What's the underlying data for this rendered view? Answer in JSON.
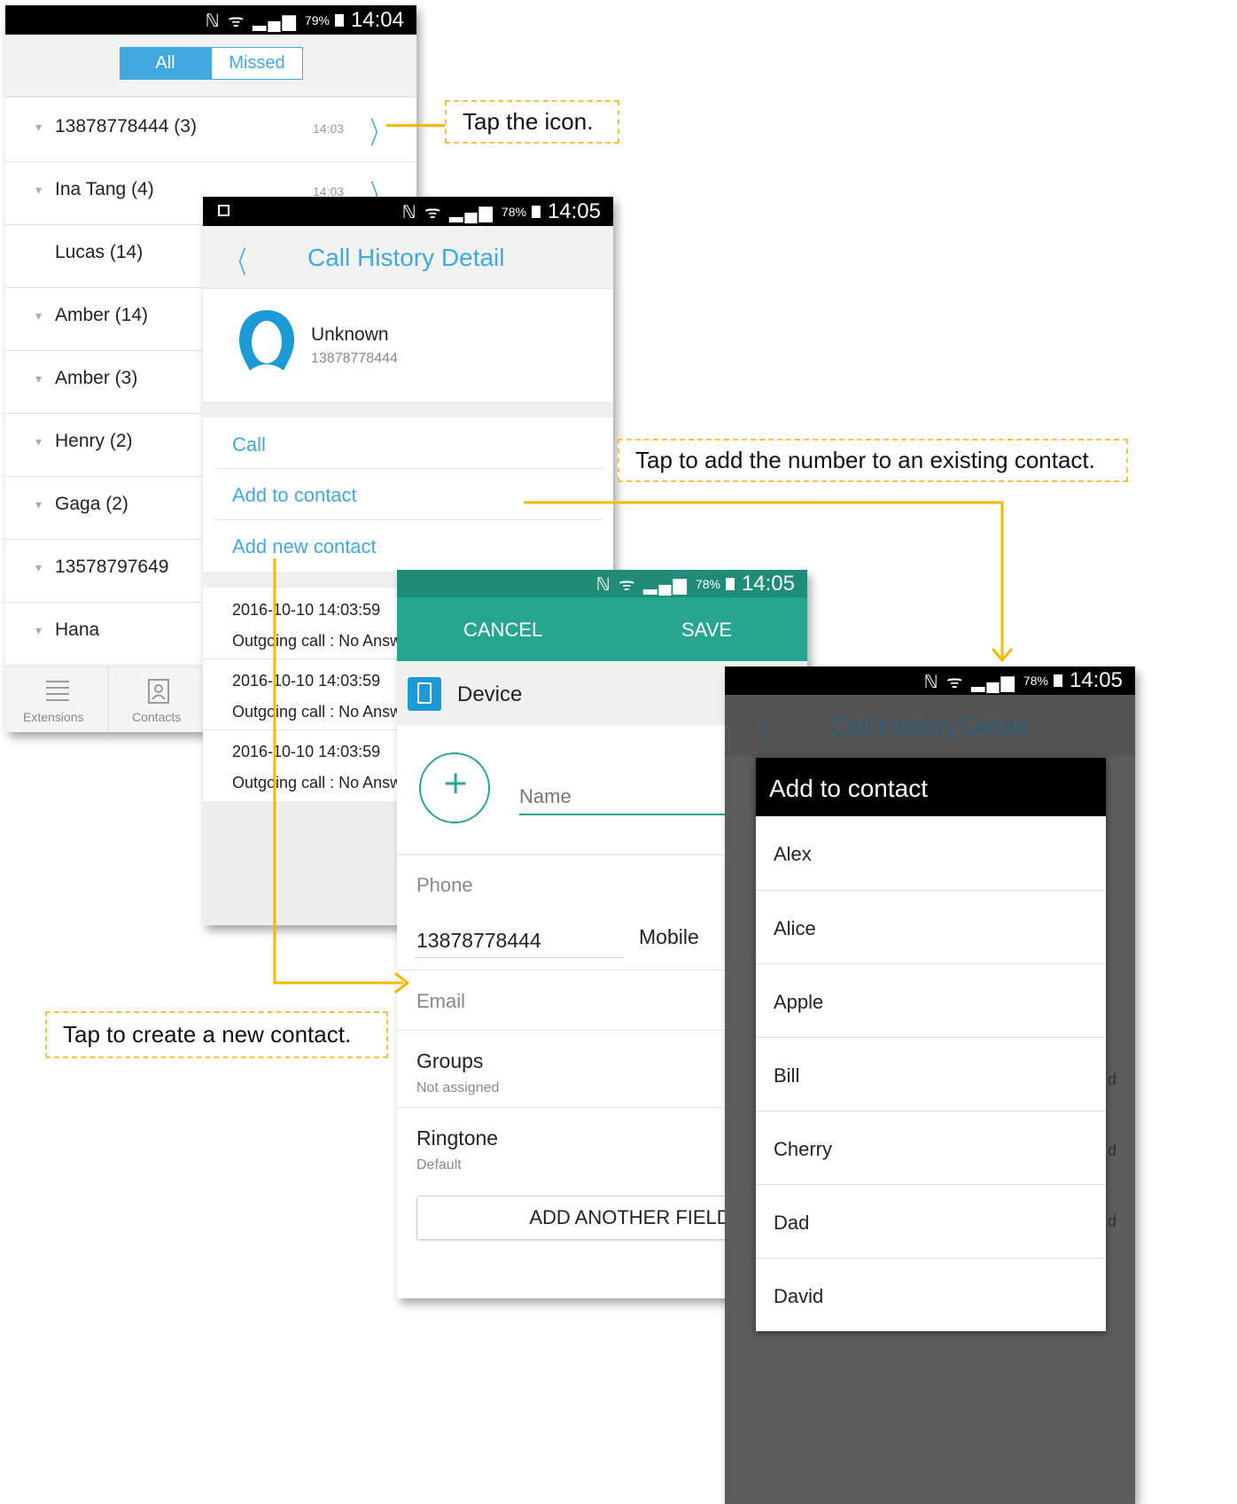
{
  "phone1": {
    "status": {
      "icons": "ℕ ᯤ ▂▄▆",
      "battery": "79%",
      "time": "14:04"
    },
    "filter": {
      "all": "All",
      "missed": "Missed"
    },
    "calls": [
      {
        "name": "13878778444 (3)",
        "time": "14:03",
        "icon": "▾",
        "chevron": "〉"
      },
      {
        "name": "Ina Tang (4)",
        "time": "14:03",
        "icon": "▾",
        "chevron": "〉"
      },
      {
        "name": "Lucas (14)",
        "time": "",
        "icon": "",
        "chevron": ""
      },
      {
        "name": "Amber (14)",
        "time": "",
        "icon": "▾",
        "chevron": ""
      },
      {
        "name": "Amber (3)",
        "time": "",
        "icon": "▾",
        "chevron": ""
      },
      {
        "name": "Henry (2)",
        "time": "",
        "icon": "▾",
        "chevron": ""
      },
      {
        "name": "Gaga (2)",
        "time": "",
        "icon": "▾",
        "chevron": ""
      },
      {
        "name": "13578797649",
        "time": "",
        "icon": "▾",
        "chevron": ""
      },
      {
        "name": "Hana",
        "time": "",
        "icon": "▾",
        "chevron": ""
      }
    ],
    "nav": {
      "extensions": "Extensions",
      "contacts": "Contacts"
    }
  },
  "phone2": {
    "status": {
      "icons": "ℕ ᯤ ▂▄▆",
      "battery": "78%",
      "time": "14:05"
    },
    "title": "Call History Detail",
    "back": "〈",
    "contact": {
      "name": "Unknown",
      "number": "13878778444"
    },
    "actions": {
      "call": "Call",
      "add_to_contact": "Add to contact",
      "add_new_contact": "Add new contact"
    },
    "history": [
      {
        "date": "2016-10-10 14:03:59",
        "desc": "Outgoing call : No Answ"
      },
      {
        "date": "2016-10-10 14:03:59",
        "desc": "Outgoing call : No Answ"
      },
      {
        "date": "2016-10-10 14:03:59",
        "desc": "Outgoing call : No Answ"
      }
    ]
  },
  "phone3": {
    "status": {
      "icons": "ℕ ᯤ ▂▄▆",
      "battery": "78%",
      "time": "14:05"
    },
    "cancel": "CANCEL",
    "save": "SAVE",
    "device_label": "Device",
    "name_placeholder": "Name",
    "plus": "+",
    "phone_label": "Phone",
    "phone_value": "13878778444",
    "phone_type": "Mobile",
    "email_label": "Email",
    "groups_label": "Groups",
    "groups_value": "Not assigned",
    "ringtone_label": "Ringtone",
    "ringtone_value": "Default",
    "add_field": "ADD ANOTHER FIELD"
  },
  "phone4": {
    "status": {
      "icons": "ℕ ᯤ ▂▄▆",
      "battery": "78%",
      "time": "14:05"
    },
    "bg_title": "Call History Detail",
    "bg_back": "〈",
    "dialog_title": "Add to contact",
    "contacts": [
      "Alex",
      "Alice",
      "Apple",
      "Bill",
      "Cherry",
      "Dad",
      "David"
    ],
    "edge_letters": [
      "d",
      "d",
      "d"
    ]
  },
  "notes": {
    "tap_icon": "Tap the icon.",
    "tap_add_existing": "Tap to add the number to an existing contact.",
    "tap_create_new": "Tap to create a new contact."
  },
  "colors": {
    "accent": "#3fa9e0",
    "teal": "#26a690",
    "callout": "#f5b800"
  }
}
